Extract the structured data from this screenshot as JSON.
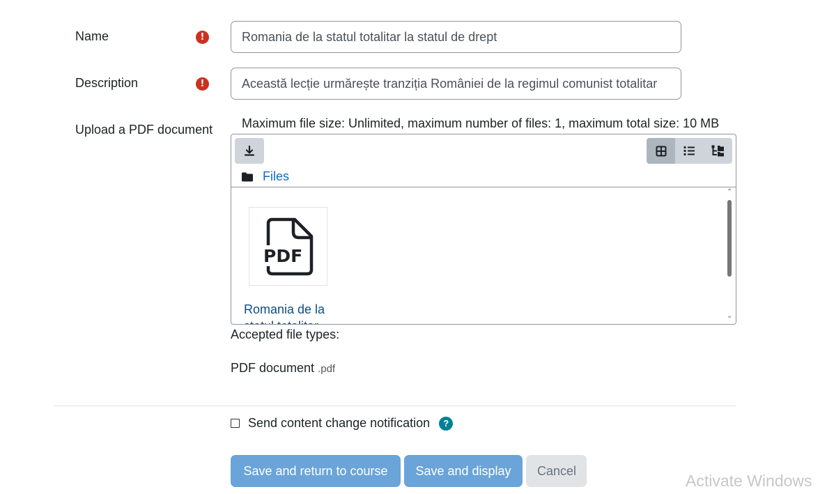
{
  "form": {
    "name": {
      "label": "Name",
      "required_icon": "exclamation-icon",
      "value": "Romania de la statul totalitar la statul de drept"
    },
    "description": {
      "label": "Description",
      "required_icon": "exclamation-icon",
      "value": "Această lecție urmărește tranziția României de la regimul comunist totalitar"
    },
    "upload": {
      "label": "Upload a PDF document",
      "info": "Maximum file size: Unlimited, maximum number of files: 1, maximum total size: 10 MB",
      "toolbar": {
        "download_icon": "download-icon",
        "views": [
          "grid-view-icon",
          "list-view-icon",
          "tree-view-icon"
        ],
        "active_view": "grid-view-icon"
      },
      "path_label": "Files",
      "file": {
        "thumb_label": "PDF",
        "name": "Romania de la statul totalitar"
      },
      "accepted_label": "Accepted file types:",
      "doc_type": "PDF document",
      "doc_ext": ".pdf"
    },
    "notify_label": "Send content change notification",
    "help_icon": "question-icon"
  },
  "buttons": {
    "save_return": "Save and return to course",
    "save_display": "Save and display",
    "cancel": "Cancel"
  },
  "watermark": "Activate Windows",
  "colors": {
    "primary": "#6aa4d8",
    "link": "#0f6cbf",
    "required": "#ca3120",
    "help": "#008196"
  }
}
